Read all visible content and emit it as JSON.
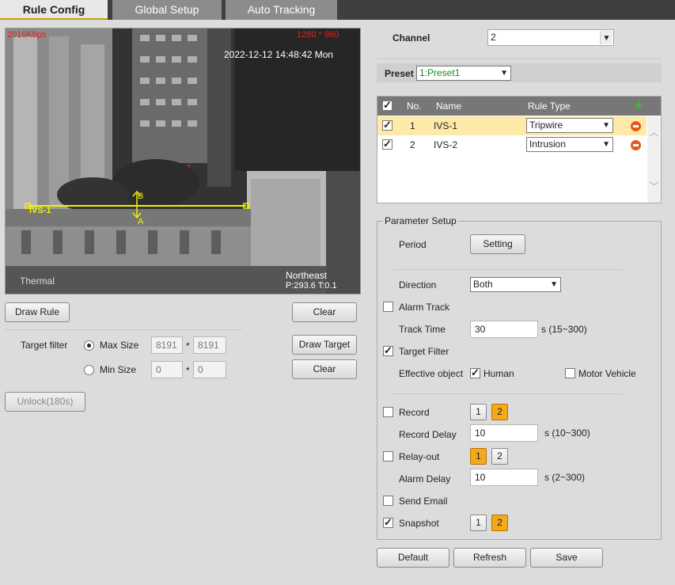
{
  "tabs": [
    {
      "label": "Rule Config"
    },
    {
      "label": "Global Setup"
    },
    {
      "label": "Auto Tracking"
    }
  ],
  "video": {
    "bitrate": "2016Kbps",
    "resolution": "1280 * 960",
    "timestamp": "2022-12-12 14:48:42 Mon",
    "rule_label": "IVS-1",
    "marker_a": "A",
    "marker_b": "B",
    "mode": "Thermal",
    "direction_text": "Northeast",
    "ptz_text": "P:293.6 T:0.1"
  },
  "left": {
    "draw_rule": "Draw Rule",
    "clear_top": "Clear",
    "target_filter_label": "Target filter",
    "max_size_label": "Max Size",
    "max_w": "8191",
    "max_h": "8191",
    "min_size_label": "Min Size",
    "min_w": "0",
    "min_h": "0",
    "times": "*",
    "draw_target": "Draw Target",
    "clear_bottom": "Clear",
    "unlock": "Unlock(180s)"
  },
  "channel": {
    "label": "Channel",
    "value": "2"
  },
  "preset": {
    "label": "Preset",
    "value": "1:Preset1"
  },
  "rules_table": {
    "headers": {
      "no": "No.",
      "name": "Name",
      "type": "Rule Type"
    },
    "rows": [
      {
        "no": "1",
        "name": "IVS-1",
        "type": "Tripwire",
        "checked": true,
        "selected": true
      },
      {
        "no": "2",
        "name": "IVS-2",
        "type": "Intrusion",
        "checked": true,
        "selected": false
      }
    ]
  },
  "params": {
    "title": "Parameter Setup",
    "period_label": "Period",
    "setting_btn": "Setting",
    "direction_label": "Direction",
    "direction_value": "Both",
    "alarm_track_label": "Alarm Track",
    "track_time_label": "Track Time",
    "track_time_value": "30",
    "track_time_range": "s (15~300)",
    "target_filter_label": "Target Filter",
    "effective_object_label": "Effective object",
    "human_label": "Human",
    "motor_vehicle_label": "Motor Vehicle",
    "record_label": "Record",
    "record_delay_label": "Record Delay",
    "record_delay_value": "10",
    "record_delay_range": "s (10~300)",
    "relay_out_label": "Relay-out",
    "alarm_delay_label": "Alarm Delay",
    "alarm_delay_value": "10",
    "alarm_delay_range": "s (2~300)",
    "send_email_label": "Send Email",
    "snapshot_label": "Snapshot",
    "ch1": "1",
    "ch2": "2"
  },
  "footer": {
    "default": "Default",
    "refresh": "Refresh",
    "save": "Save"
  },
  "colors": {
    "accent_orange": "#f4a81c",
    "selected_row": "#fde9a8",
    "overlay_red": "#e32020",
    "rule_yellow": "#f2f200"
  }
}
